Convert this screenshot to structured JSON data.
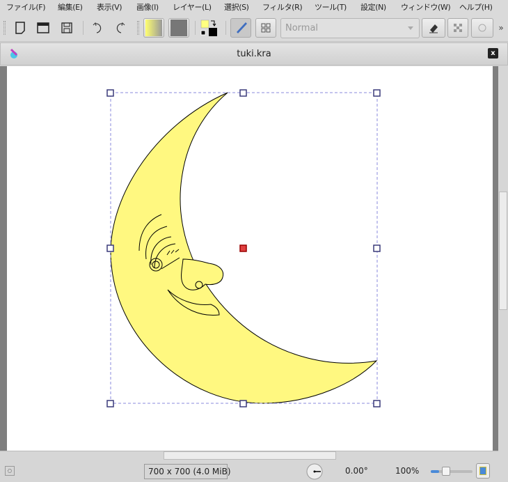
{
  "menu": [
    "ファイル(F)",
    "編集(E)",
    "表示(V)",
    "画像(I)",
    "レイヤー(L)",
    "選択(S)",
    "フィルタ(R)",
    "ツール(T)",
    "設定(N)",
    "ウィンドウ(W)",
    "ヘルプ(H)"
  ],
  "toolbar": {
    "blend_mode": "Normal",
    "overflow": "»",
    "icons": [
      "new-document-icon",
      "open-folder-icon",
      "save-icon",
      "undo-icon",
      "redo-icon",
      "gradient-icon",
      "pattern-icon",
      "color-swap-icon",
      "brush-icon",
      "grid-icon",
      "eraser-icon",
      "alpha-lock-icon",
      "reload-icon"
    ]
  },
  "colors": {
    "foreground": "#000000",
    "background": "#ffff80",
    "moon_fill": "#fff880",
    "handle": "#3a3a7a",
    "center_handle": "#e04040"
  },
  "document": {
    "title": "tuki.kra",
    "close": "x"
  },
  "status": {
    "size": "700 x 700 (4.0 MiB)",
    "rotation": "0.00°",
    "zoom": "100%",
    "zoom_slider_fraction": 0.2
  }
}
